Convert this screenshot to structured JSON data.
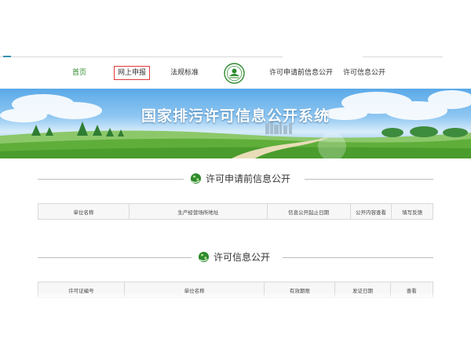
{
  "nav": {
    "items": [
      {
        "label": "首页"
      },
      {
        "label": "网上申报"
      },
      {
        "label": "法规标准"
      },
      {
        "label": "许可申请前信息公开"
      },
      {
        "label": "许可信息公开"
      }
    ]
  },
  "banner": {
    "title": "国家排污许可信息公开系统"
  },
  "sections": [
    {
      "title": "许可申请前信息公开",
      "columns": [
        "单位名称",
        "生产经营场所地址",
        "信息公开起止日期",
        "公开内容查看",
        "填写反馈"
      ]
    },
    {
      "title": "许可信息公开",
      "columns": [
        "许可证编号",
        "单位名称",
        "有效期限",
        "发证日期",
        "查看"
      ]
    }
  ],
  "colors": {
    "accent_green": "#2e8b2e",
    "highlight_box": "#e03a3a",
    "rule": "#bdbdbd"
  }
}
